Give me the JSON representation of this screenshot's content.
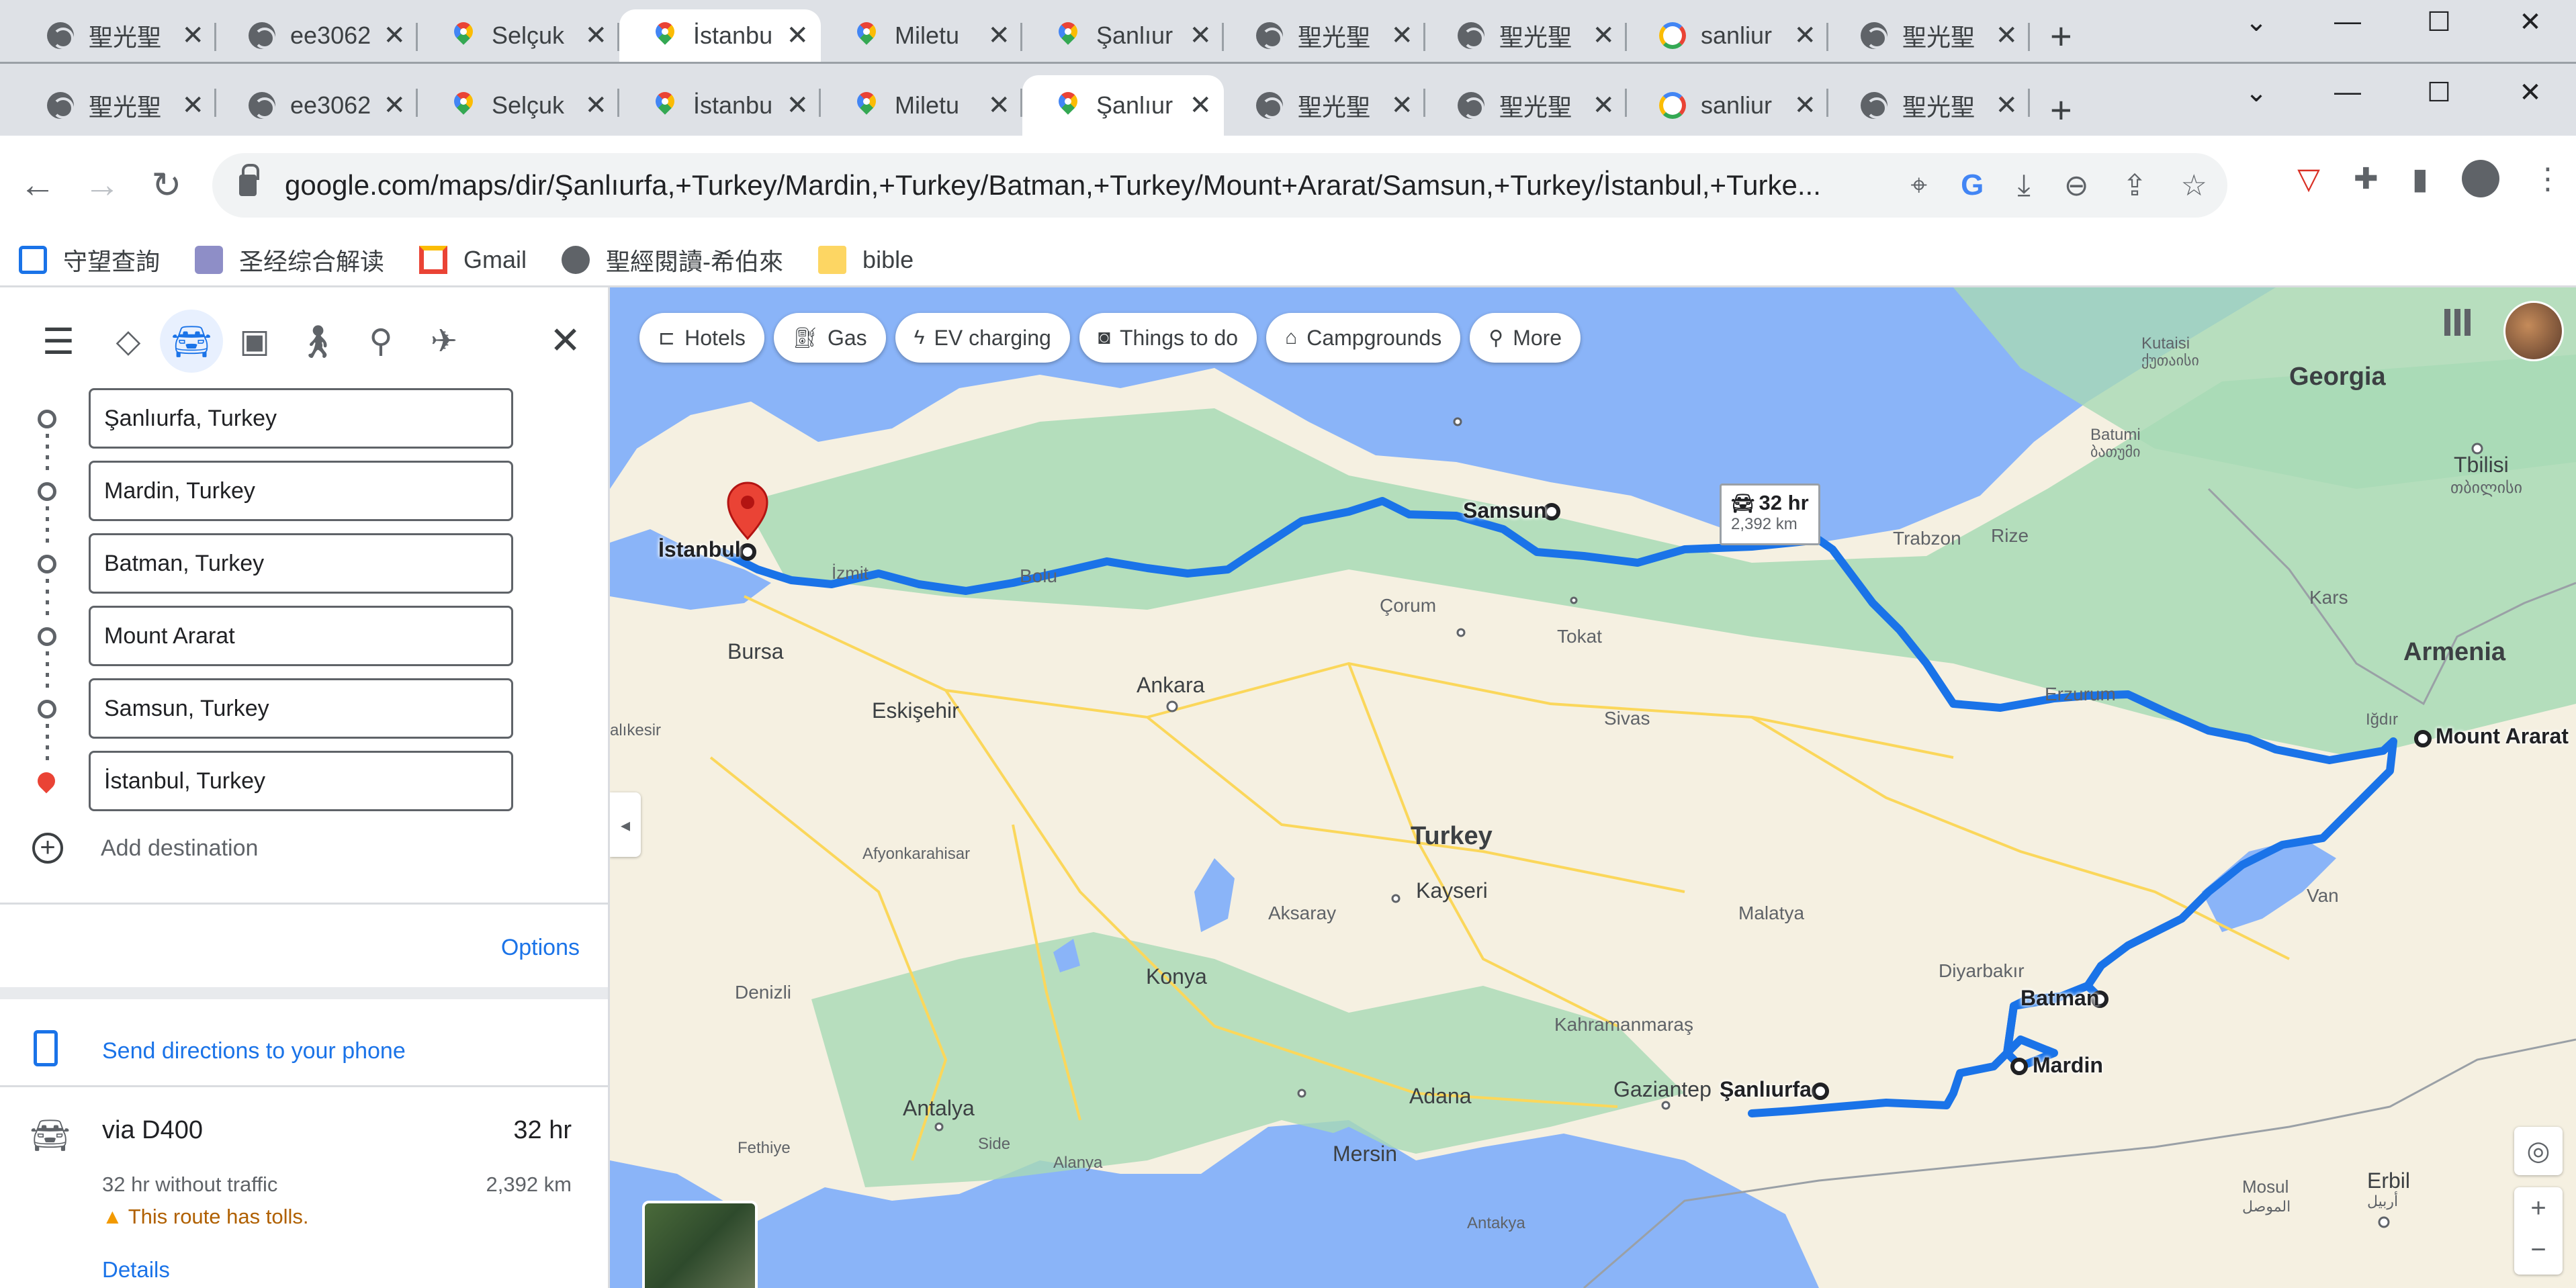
{
  "browser": {
    "back_tabs": [
      {
        "icon": "globe-icon",
        "title": "聖光聖"
      },
      {
        "icon": "globe-icon",
        "title": "ee3062"
      },
      {
        "icon": "maps-icon",
        "title": "Selçuk"
      },
      {
        "icon": "maps-icon",
        "title": "İstanbu",
        "active": true
      },
      {
        "icon": "maps-icon",
        "title": "Miletu"
      },
      {
        "icon": "maps-icon",
        "title": "Şanlıur"
      },
      {
        "icon": "globe-icon",
        "title": "聖光聖"
      },
      {
        "icon": "globe-icon",
        "title": "聖光聖"
      },
      {
        "icon": "google-icon",
        "title": "sanliur"
      },
      {
        "icon": "globe-icon",
        "title": "聖光聖"
      }
    ],
    "front_tabs": [
      {
        "icon": "globe-icon",
        "title": "聖光聖"
      },
      {
        "icon": "globe-icon",
        "title": "ee3062"
      },
      {
        "icon": "maps-icon",
        "title": "Selçuk"
      },
      {
        "icon": "maps-icon",
        "title": "İstanbu"
      },
      {
        "icon": "maps-icon",
        "title": "Miletu"
      },
      {
        "icon": "maps-icon",
        "title": "Şanlıur",
        "active": true
      },
      {
        "icon": "globe-icon",
        "title": "聖光聖"
      },
      {
        "icon": "globe-icon",
        "title": "聖光聖"
      },
      {
        "icon": "google-icon",
        "title": "sanliur"
      },
      {
        "icon": "globe-icon",
        "title": "聖光聖"
      }
    ],
    "url": "google.com/maps/dir/Şanlıurfa,+Turkey/Mardin,+Turkey/Batman,+Turkey/Mount+Ararat/Samsun,+Turkey/İstanbul,+Turke...",
    "bookmarks": [
      {
        "icon": "watchtower-icon",
        "label": "守望查詢"
      },
      {
        "icon": "bible-tree-icon",
        "label": "圣经综合解读"
      },
      {
        "icon": "gmail-icon",
        "label": "Gmail"
      },
      {
        "icon": "globe-icon",
        "label": "聖經閱讀-希伯來"
      },
      {
        "icon": "folder-icon",
        "label": "bible"
      }
    ]
  },
  "directions": {
    "stops": [
      "Şanlıurfa, Turkey",
      "Mardin, Turkey",
      "Batman, Turkey",
      "Mount Ararat",
      "Samsun, Turkey",
      "İstanbul, Turkey"
    ],
    "add_destination": "Add destination",
    "options": "Options",
    "send_to_phone": "Send directions to your phone",
    "route": {
      "via": "via D400",
      "time": "32 hr",
      "no_traffic": "32 hr without traffic",
      "distance": "2,392 km",
      "tolls": "This route has tolls.",
      "details": "Details"
    }
  },
  "map": {
    "chips": [
      {
        "icon": "bed-icon",
        "label": "Hotels"
      },
      {
        "icon": "gas-icon",
        "label": "Gas"
      },
      {
        "icon": "ev-charging-icon",
        "label": "EV charging"
      },
      {
        "icon": "camera-icon",
        "label": "Things to do"
      },
      {
        "icon": "tent-icon",
        "label": "Campgrounds"
      },
      {
        "icon": "search-icon",
        "label": "More"
      }
    ],
    "timebox": {
      "time": "32 hr",
      "distance": "2,392 km"
    },
    "labels": {
      "georgia": "Georgia",
      "armenia": "Armenia",
      "turkey": "Turkey",
      "tbilisi": "Tbilisi",
      "tbilisi_ka": "თბილისი",
      "kutaisi": "Kutaisi",
      "kutaisi_ka": "ქუთაისი",
      "batumi": "Batumi",
      "batumi_ka": "ბათუმი",
      "trabzon": "Trabzon",
      "rize": "Rize",
      "kars": "Kars",
      "igdir": "Iğdır",
      "erzurum": "Erzurum",
      "van": "Van",
      "samsun": "Samsun",
      "istanbul": "İstanbul",
      "izmit": "İzmit",
      "bolu": "Bolu",
      "corum": "Çorum",
      "tokat": "Tokat",
      "sivas": "Sivas",
      "ankara": "Ankara",
      "bursa": "Bursa",
      "eskisehir": "Eskişehir",
      "balikesir": "alıkesir",
      "afyonkarahisar": "Afyonkarahisar",
      "aksaray": "Aksaray",
      "kayseri": "Kayseri",
      "malatya": "Malatya",
      "diyarbakir": "Diyarbakır",
      "batman": "Batman",
      "mardin": "Mardin",
      "kahramanmaras": "Kahramanmaraş",
      "gaziantep": "Gaziantep",
      "sanliurfa": "Şanlıurfa",
      "konya": "Konya",
      "denizli": "Denizli",
      "antalya": "Antalya",
      "fethiye": "Fethiye",
      "side": "Side",
      "alanya": "Alanya",
      "adana": "Adana",
      "mersin": "Mersin",
      "antakya": "Antakya",
      "mosul": "Mosul",
      "mosul_ar": "الموصل",
      "erbil": "Erbil",
      "erbil_ar": "أربيل",
      "mount_ararat": "Mount Ararat"
    },
    "colors": {
      "route": "#1a73e8",
      "water": "#8ab4f8",
      "land": "#f5f0e1",
      "forest": "#a8dab5"
    }
  }
}
